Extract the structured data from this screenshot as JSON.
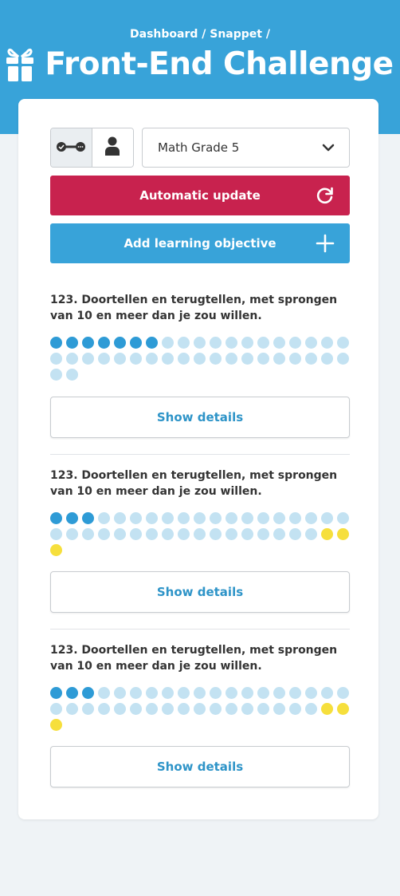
{
  "header": {
    "breadcrumb": "Dashboard / Snappet /",
    "title": "Front-End Challenge",
    "icon": "gift-icon",
    "background": "#38a3d9"
  },
  "controls": {
    "toggle_options": [
      {
        "icon": "progress-icon",
        "active": true
      },
      {
        "icon": "person-icon",
        "active": false
      }
    ],
    "subject_select": {
      "value": "Math Grade 5",
      "icon": "chevron-down-icon"
    }
  },
  "actions": {
    "update_label": "Automatic update",
    "update_icon": "refresh-icon",
    "update_color": "#c8224e",
    "add_label": "Add learning objective",
    "add_icon": "plus-icon",
    "add_color": "#38a3d9"
  },
  "colors": {
    "dot_done": "#2e9bd6",
    "dot_todo": "#c3e2f2",
    "dot_extra": "#f6df3c"
  },
  "objectives": [
    {
      "line1": "123. Doortellen en terugtellen, met sprongen",
      "line2": "van 10 en meer dan je zou willen.",
      "dots_done": 7,
      "dots_todo": 33,
      "dots_extra": 0,
      "details_label": "Show details"
    },
    {
      "line1": "123. Doortellen en terugtellen, met sprongen",
      "line2": "van 10 en meer dan je zou willen.",
      "dots_done": 3,
      "dots_todo": 33,
      "dots_extra": 3,
      "details_label": "Show details"
    },
    {
      "line1": "123. Doortellen en terugtellen, met sprongen",
      "line2": "van 10 en meer dan je zou willen.",
      "dots_done": 3,
      "dots_todo": 33,
      "dots_extra": 3,
      "details_label": "Show details"
    }
  ]
}
